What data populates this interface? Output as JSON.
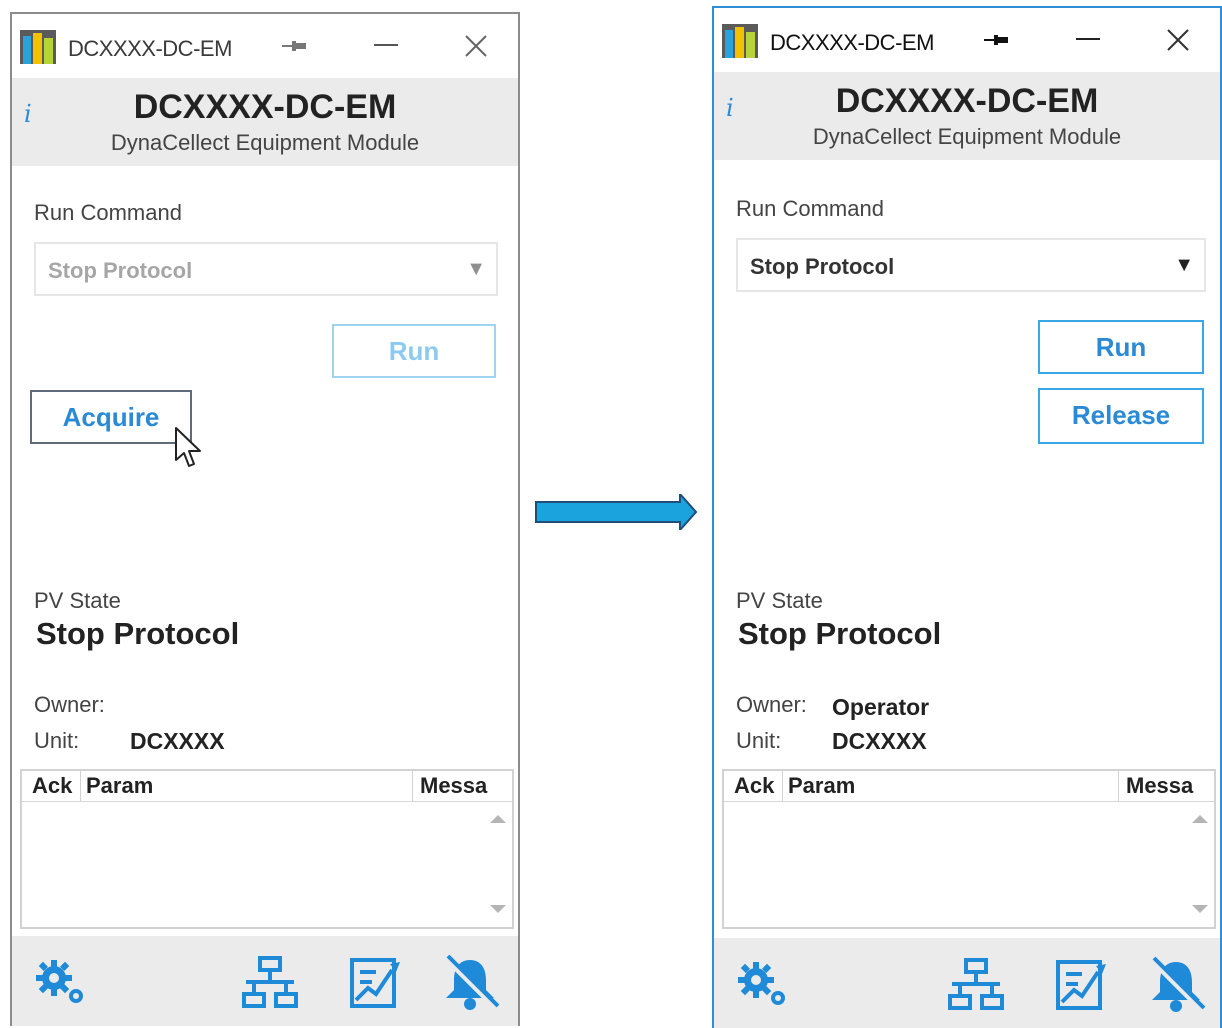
{
  "colors": {
    "accent": "#2a8ad6",
    "accent_light": "#3aa6e6",
    "disabled": "#a6a6a6",
    "arrow": "#1ba3dd"
  },
  "left": {
    "title": "DCXXXX-DC-EM",
    "module_name": "DCXXXX-DC-EM",
    "module_sub": "DynaCellect Equipment Module",
    "info": "i",
    "run_command_label": "Run Command",
    "run_command_value": "Stop Protocol",
    "run_button": "Run",
    "acquire_button": "Acquire",
    "pv_state_label": "PV State",
    "pv_state_value": "Stop Protocol",
    "owner_label": "Owner:",
    "owner_value": "",
    "unit_label": "Unit:",
    "unit_value": "DCXXXX",
    "table": {
      "ack": "Ack",
      "param": "Param",
      "message": "Messa"
    }
  },
  "right": {
    "title": "DCXXXX-DC-EM",
    "module_name": "DCXXXX-DC-EM",
    "module_sub": "DynaCellect Equipment Module",
    "info": "i",
    "run_command_label": "Run Command",
    "run_command_value": "Stop Protocol",
    "run_button": "Run",
    "release_button": "Release",
    "pv_state_label": "PV State",
    "pv_state_value": "Stop Protocol",
    "owner_label": "Owner:",
    "owner_value": "Operator",
    "unit_label": "Unit:",
    "unit_value": "DCXXXX",
    "table": {
      "ack": "Ack",
      "param": "Param",
      "message": "Messa"
    }
  },
  "icons": [
    "app-icon",
    "pin-icon",
    "minimize-icon",
    "close-icon",
    "info-icon",
    "settings-icon",
    "network-icon",
    "chart-icon",
    "alarm-muted-icon",
    "arrow-right-icon",
    "cursor-icon"
  ]
}
